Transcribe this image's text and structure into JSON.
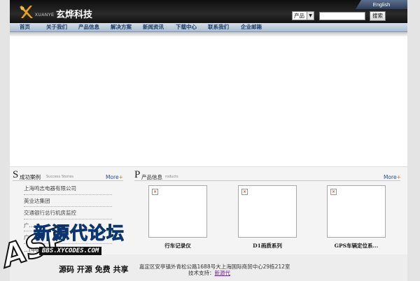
{
  "brand": {
    "name": "玄烨科技",
    "sub": "XUANYE",
    "accent": "#e07010"
  },
  "header": {
    "lang_link": "English",
    "search": {
      "category": "产品",
      "value": "",
      "button": "搜索"
    }
  },
  "nav": {
    "items": [
      "首页",
      "关于我们",
      "产品信息",
      "解决方案",
      "新闻资讯",
      "下载中心",
      "联系我们",
      "企业邮箱"
    ]
  },
  "cases": {
    "initial": "S",
    "title": "成功案例",
    "subtitle": "Success Stories",
    "more": "More",
    "items": [
      "上海鸣志电器有限公司",
      "英业达集团",
      "交通银行总行机房监控",
      "广...",
      "广...",
      "...(中国)有限公司"
    ]
  },
  "products": {
    "initial": "P",
    "title": "产品信息",
    "subtitle": "roducts",
    "more": "More",
    "items": [
      {
        "name": "行车记录仪"
      },
      {
        "name": "D1画质系列"
      },
      {
        "name": "GPS车辆定位系..."
      }
    ]
  },
  "footer": {
    "address": "嘉定区安亭镇外青松公路1688号大上海国际商贸中心29栋212室",
    "support_label": "技术支持：",
    "support_link": "新源代"
  },
  "watermark": {
    "title": "新源代论坛",
    "url": "BBS.XYCODES.COM",
    "slogan": "源码 开源 免费 共享",
    "asp": "ASP"
  }
}
